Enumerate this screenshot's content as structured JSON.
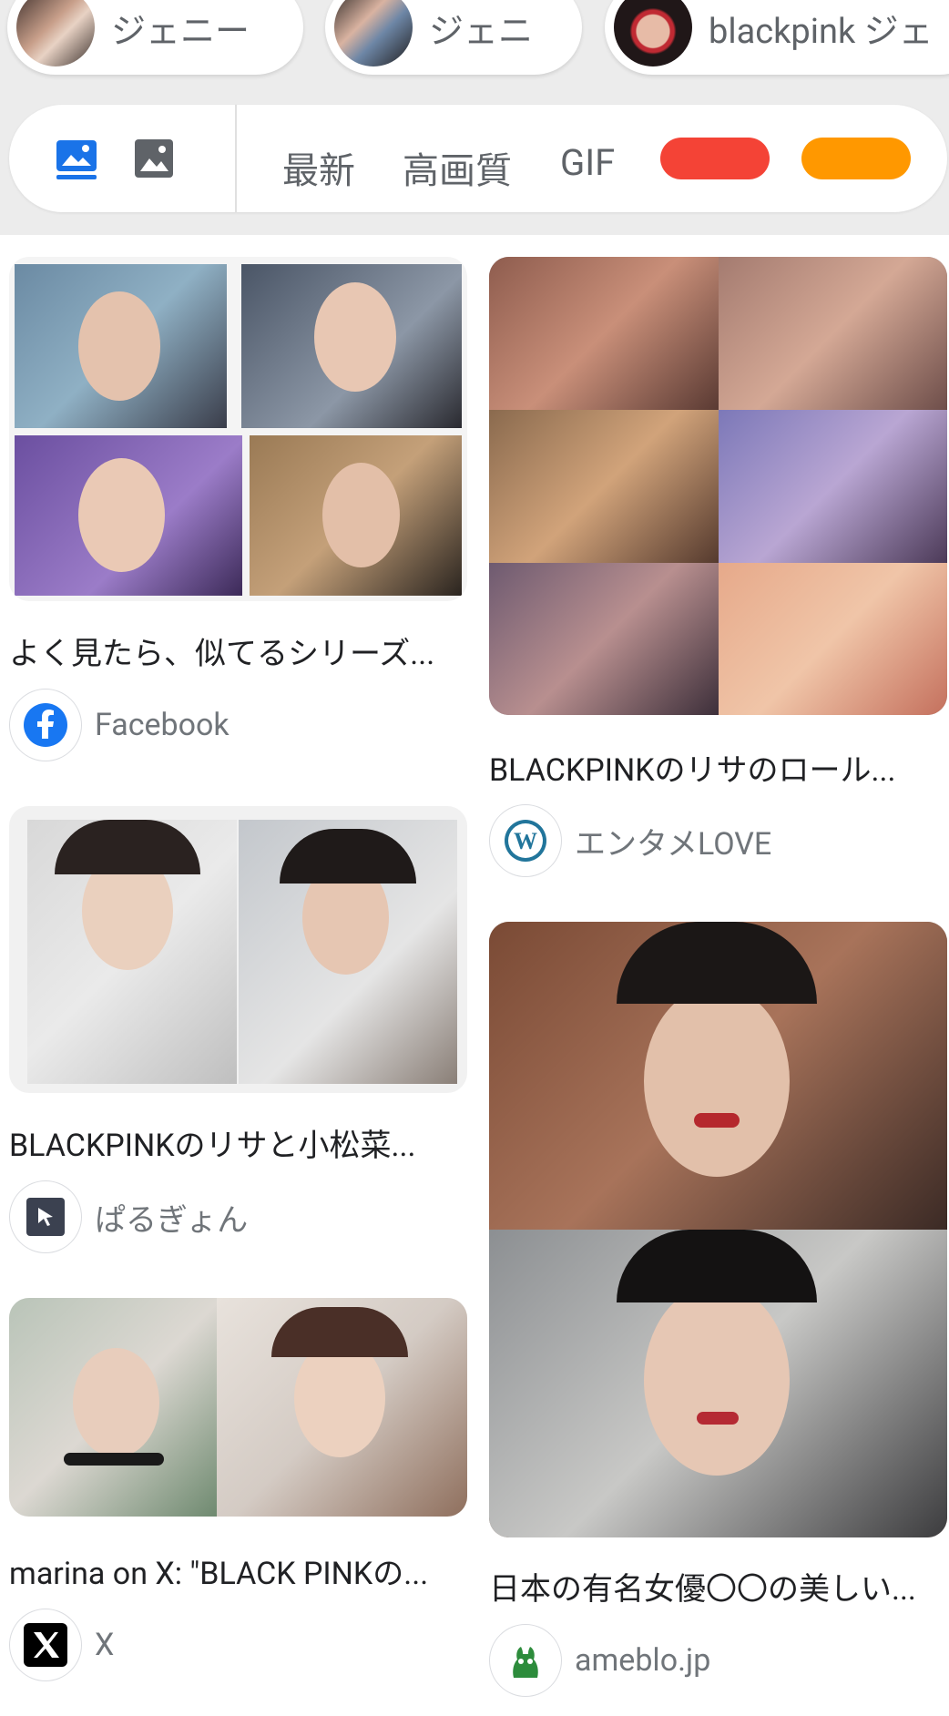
{
  "related_chips": [
    {
      "label": "ジェニー"
    },
    {
      "label": "ジェニ"
    },
    {
      "label": "blackpink ジェ"
    }
  ],
  "filters": {
    "icons": [
      "image-search-icon",
      "image-icon"
    ],
    "tags": [
      "最新",
      "高画質",
      "GIF"
    ],
    "color_swatches": [
      "#f44336",
      "#ff9800"
    ],
    "active_icon_color": "#1a73e8"
  },
  "results": [
    {
      "title": "よく見たら、似てるシリーズ...",
      "source": "Facebook",
      "favicon": "facebook-icon"
    },
    {
      "title": "BLACKPINKのリサのロール...",
      "source": "エンタメLOVE",
      "favicon": "wordpress-icon"
    },
    {
      "title": "BLACKPINKのリサと小松菜...",
      "source": "ぱるぎょん",
      "favicon": "cursor-icon"
    },
    {
      "title": "日本の有名女優〇〇の美しい...",
      "source": "ameblo.jp",
      "favicon": "ameba-icon"
    },
    {
      "title": "marina on X: \"BLACK PINKの...",
      "source": "X",
      "favicon": "x-logo-icon"
    }
  ]
}
